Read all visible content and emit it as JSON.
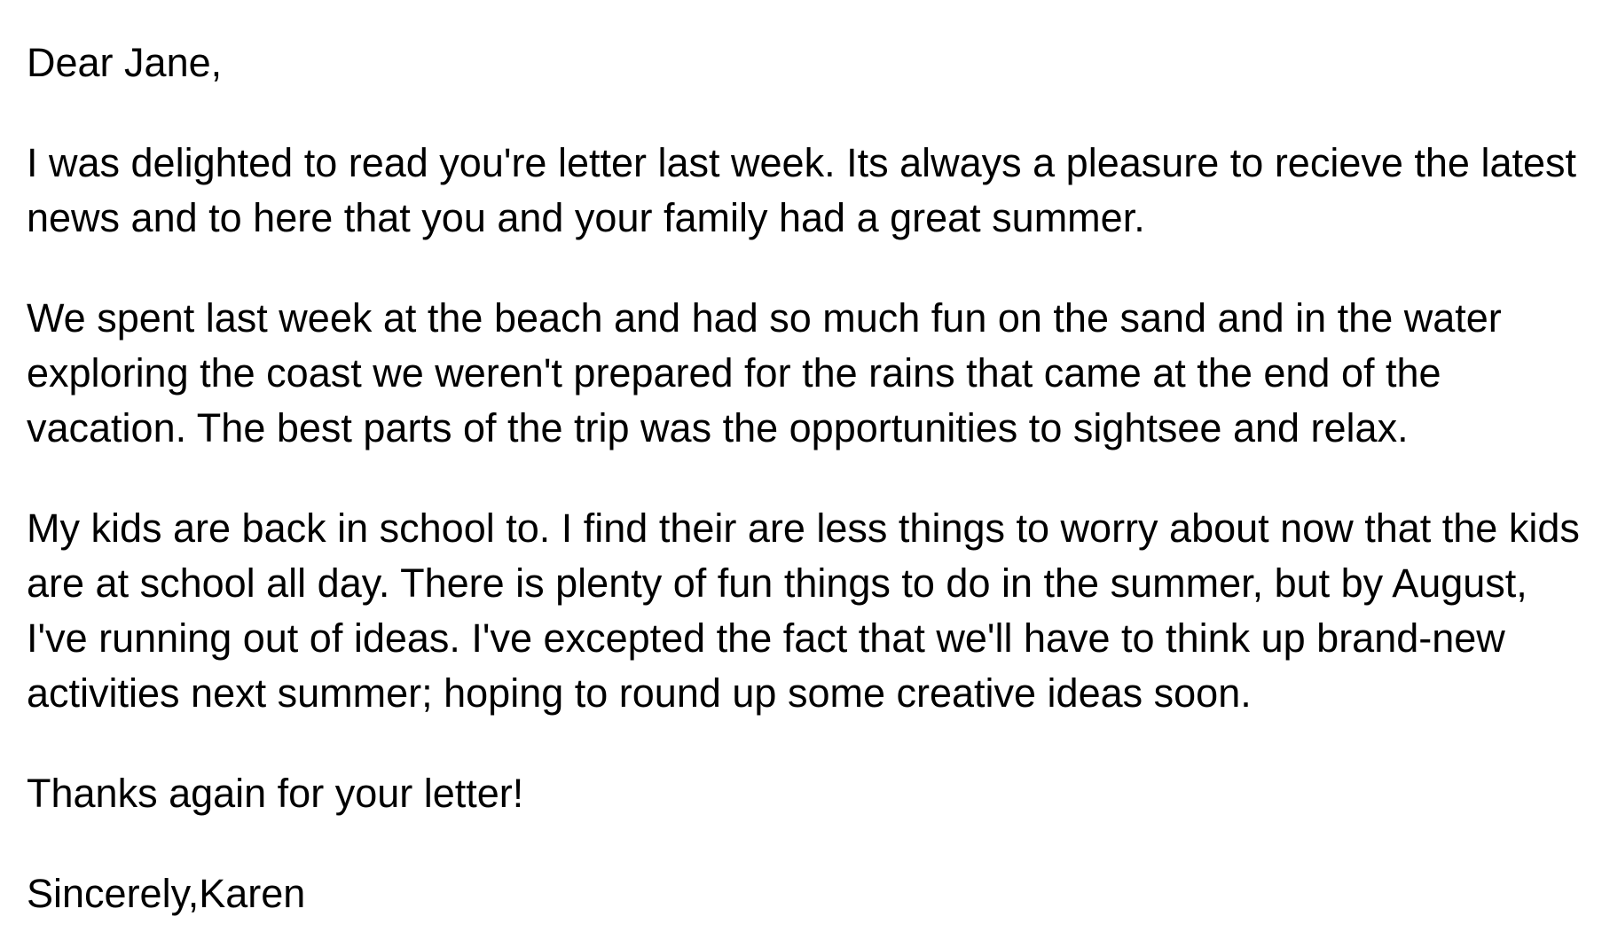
{
  "letter": {
    "greeting": "Dear Jane,",
    "paragraphs": [
      "I was delighted to read you're letter last week. Its always a pleasure to recieve the latest news and to here that you and your family had a great summer.",
      "We spent last week at the beach and had so much fun on the sand and in the water exploring the coast we weren't prepared for the rains that came at the end of the vacation. The best parts of the trip was the opportunities to sightsee and relax.",
      "My kids are back in school to. I find their are less things to worry about now that the kids are at school all day. There is plenty of fun things to do in the summer, but by August, I've running out of ideas. I've excepted the fact that we'll have to think up brand-new activities next summer; hoping to round up some creative ideas soon."
    ],
    "closing_line": "Thanks again for your letter!",
    "signoff": "Sincerely,Karen"
  }
}
